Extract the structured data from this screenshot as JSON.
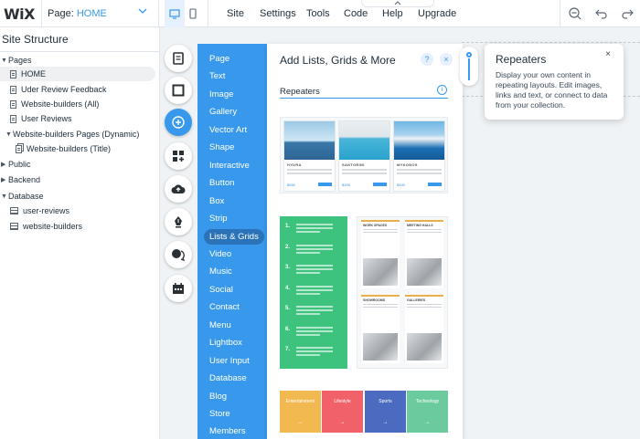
{
  "topbar": {
    "logo": "WiX",
    "page_label": "Page:",
    "page_value": "HOME",
    "menu": [
      "Site",
      "Settings",
      "Tools",
      "Code",
      "Help",
      "Upgrade"
    ]
  },
  "site_structure": {
    "title": "Site Structure",
    "items": [
      {
        "label": "Pages",
        "type": "group"
      },
      {
        "label": "HOME",
        "type": "page",
        "selected": true
      },
      {
        "label": "Uder Review Feedback",
        "type": "page"
      },
      {
        "label": "Website-builders (All)",
        "type": "page"
      },
      {
        "label": "User Reviews",
        "type": "page"
      },
      {
        "label": "Website-builders Pages (Dynamic)",
        "type": "group"
      },
      {
        "label": "Website-builders (Title)",
        "type": "dynamic-page"
      },
      {
        "label": "Public",
        "type": "group-collapsed"
      },
      {
        "label": "Backend",
        "type": "group-collapsed"
      },
      {
        "label": "Database",
        "type": "group"
      },
      {
        "label": "user-reviews",
        "type": "collection"
      },
      {
        "label": "website-builders",
        "type": "collection"
      }
    ]
  },
  "add_menu": {
    "icons": [
      "menus-pages-icon",
      "background-icon",
      "add-icon",
      "app-market-icon",
      "media-upload-icon",
      "blog-pen-icon",
      "chat-icon",
      "bookings-icon"
    ],
    "categories": [
      "Page",
      "Text",
      "Image",
      "Gallery",
      "Vector Art",
      "Shape",
      "Interactive",
      "Button",
      "Box",
      "Strip",
      "Lists & Grids",
      "Video",
      "Music",
      "Social",
      "Contact",
      "Menu",
      "Lightbox",
      "User Input",
      "Database",
      "Blog",
      "Store",
      "Members"
    ],
    "active_category": "Lists & Grids"
  },
  "panel": {
    "title": "Add Lists, Grids & More",
    "help": "?",
    "close": "×",
    "section": "Repeaters",
    "info": "i",
    "cards": [
      {
        "name": "HYDRA",
        "price": "$550"
      },
      {
        "name": "SANTORINI",
        "price": "$399"
      },
      {
        "name": "MYKONOS",
        "price": "$499"
      }
    ],
    "steps": [
      "1.",
      "2.",
      "3.",
      "4.",
      "5.",
      "6.",
      "7."
    ],
    "tiles": [
      "WORK SPACES",
      "MEETING HALLS",
      "SHOWROOMS",
      "GALLERIES"
    ],
    "categories": [
      {
        "label": "Entertainment",
        "color": "#f2b950"
      },
      {
        "label": "Lifestyle",
        "color": "#f0616a"
      },
      {
        "label": "Sports",
        "color": "#4a6bbf"
      },
      {
        "label": "Technology",
        "color": "#6ccb9e"
      }
    ],
    "arrow": "→"
  },
  "tooltip": {
    "title": "Repeaters",
    "body": "Display your own content in repeating layouts. Edit images, links and text, or connect to data from your collection.",
    "close": "×"
  },
  "colors": {
    "accent": "#3899ec",
    "active_category": "#2a73b8"
  }
}
